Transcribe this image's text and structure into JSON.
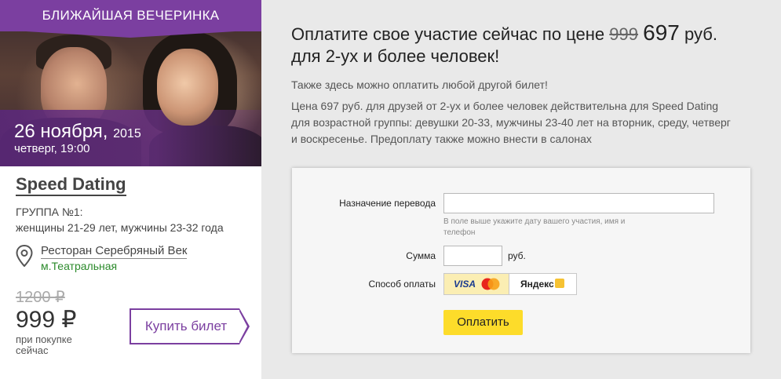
{
  "event": {
    "banner": "БЛИЖАЙШАЯ ВЕЧЕРИНКА",
    "date": "26 ноября,",
    "year": "2015",
    "day_time": "четверг, 19:00",
    "title": "Speed Dating",
    "group_line1": "ГРУППА №1:",
    "group_line2": "женщины 21-29 лет, мужчины 23-32 года",
    "venue": "Ресторан Серебряный Век",
    "metro": "м.Театральная",
    "old_price": "1200 ₽",
    "price": "999 ₽",
    "price_note": "при покупке сейчас",
    "buy_label": "Купить билет"
  },
  "offer": {
    "headline_pre": "Оплатите свое участие сейчас по цене",
    "headline_old": "999",
    "headline_new": "697",
    "headline_post": "руб.",
    "headline_line2": "для 2-ух и более человек!",
    "para1": "Также здесь можно оплатить любой другой билет!",
    "para2": "Цена 697 руб. для друзей от 2-ух и более человек действительна для Speed Dating для возрастной группы: девушки 20-33, мужчины 23-40 лет на вторник, среду, четверг и воскресенье. Предоплату также можно внести в салонах"
  },
  "form": {
    "purpose_label": "Назначение перевода",
    "purpose_value": "",
    "purpose_hint": "В поле выше укажите дату вашего участия, имя и телефон",
    "sum_label": "Сумма",
    "sum_value": "",
    "sum_unit": "руб.",
    "method_label": "Способ оплаты",
    "method_card_text": "VISA",
    "method_yandex_text": "Яндекс",
    "pay_label": "Оплатить"
  },
  "colors": {
    "brand_purple": "#7b3fa0",
    "pay_yellow": "#fddc2a",
    "metro_green": "#2b8a2b"
  }
}
